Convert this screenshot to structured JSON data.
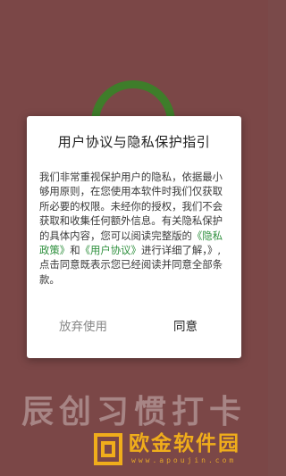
{
  "dialog": {
    "title": "用户协议与隐私保护指引",
    "body_intro": "我们非常重视保护用户的隐私，依据最小够用原则，在您使用本软件时我们仅获取所必要的权限。未经你的授权，我们不会获取和收集任何额外信息。有关隐私保护的具体内容，您可以阅读完整版的",
    "privacy_link": "《隐私政策》",
    "and_text": "和",
    "user_agreement_link": "《用户协议》",
    "body_outro": "进行详细了解，》,点击同意既表示您已经阅读并同意全部条款。",
    "cancel_label": "放弃使用",
    "agree_label": "同意"
  },
  "app": {
    "name": "辰创习惯打卡"
  },
  "watermark": {
    "title": "欧金软件园",
    "url": "www.apoujin.com"
  },
  "colors": {
    "background": "#7b4747",
    "logo_green": "#3e7d2a",
    "link_green": "#2e8f3d",
    "watermark_orange": "#f0ad1b"
  }
}
